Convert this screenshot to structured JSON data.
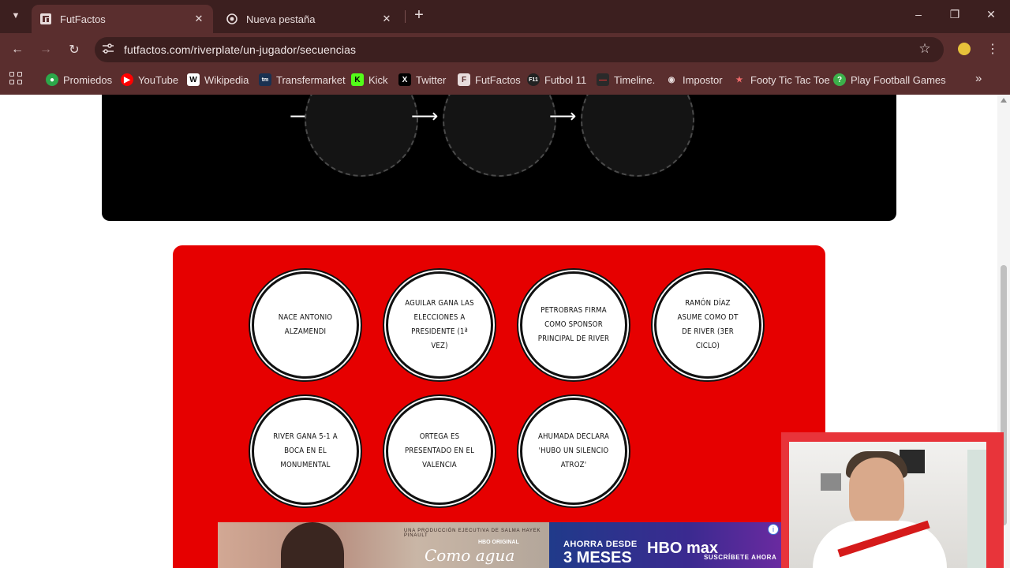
{
  "browser": {
    "tabs": [
      {
        "title": "FutFactos",
        "active": true
      },
      {
        "title": "Nueva pestaña",
        "active": false
      }
    ],
    "url": "futfactos.com/riverplate/un-jugador/secuencias",
    "bookmarks": [
      {
        "label": "Promiedos",
        "icon": "promiedos-icon"
      },
      {
        "label": "YouTube",
        "icon": "youtube-icon"
      },
      {
        "label": "Wikipedia",
        "icon": "wikipedia-icon"
      },
      {
        "label": "Transfermarket",
        "icon": "transfermarkt-icon"
      },
      {
        "label": "Kick",
        "icon": "kick-icon"
      },
      {
        "label": "Twitter",
        "icon": "x-icon"
      },
      {
        "label": "FutFactos",
        "icon": "futfactos-icon"
      },
      {
        "label": "Futbol 11",
        "icon": "futbol11-icon"
      },
      {
        "label": "Timeline.",
        "icon": "timeline-icon"
      },
      {
        "label": "Impostor",
        "icon": "impostor-icon"
      },
      {
        "label": "Footy Tic Tac Toe",
        "icon": "footy-icon"
      },
      {
        "label": "Play Football Games",
        "icon": "play-football-icon"
      }
    ]
  },
  "sequence": {
    "slots": 3,
    "events": [
      {
        "text": "Nace Antonio Alzamendi"
      },
      {
        "text": "Aguilar gana las elecciones a presidente (1ª vez)"
      },
      {
        "text": "Petrobras firma como sponsor principal de River"
      },
      {
        "text": "Ramón Díaz asume como DT de River (3er ciclo)"
      },
      {
        "text": "River gana 5-1 a Boca en el Monumental"
      },
      {
        "text": "Ortega es presentado en el Valencia"
      },
      {
        "text": "Ahumada declara 'hubo un silencio atroz'"
      }
    ]
  },
  "ad": {
    "production": "UNA PRODUCCIÓN EJECUTIVA DE SALMA HAYEK PINAULT",
    "badge": "HBO ORIGINAL",
    "title": "Como agua para chocolate",
    "offer_line1": "AHORRA DESDE",
    "offer_line2": "3 MESES",
    "brand": "HBO max",
    "cta": "SUSCRÍBETE AHORA"
  },
  "colors": {
    "chrome": "#5a2e2e",
    "tabstrip": "#3c1f1f",
    "accent_red": "#e60000",
    "card_black": "#000000"
  }
}
